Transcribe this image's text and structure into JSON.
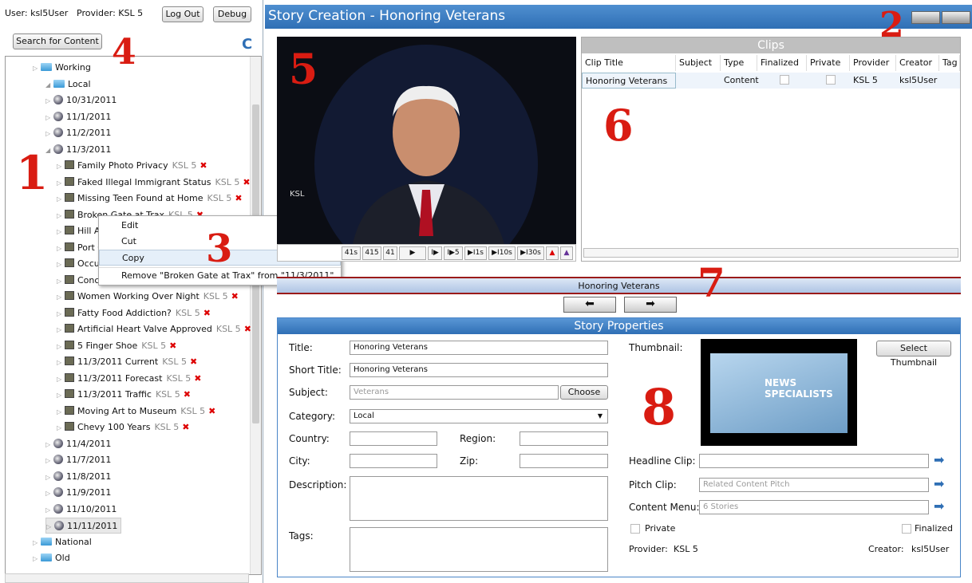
{
  "left": {
    "user_label": "User: ksl5User",
    "provider_label": "Provider: KSL 5",
    "logout_label": "Log Out",
    "debug_label": "Debug",
    "search_label": "Search for Content",
    "refresh_icon": "C",
    "tree": {
      "working": "Working",
      "local": "Local",
      "dates_top": [
        "10/31/2011",
        "11/1/2011",
        "11/2/2011",
        "11/3/2011"
      ],
      "stories": [
        {
          "title": "Family Photo Privacy",
          "prov": "KSL 5"
        },
        {
          "title": "Faked Illegal Immigrant Status",
          "prov": "KSL 5"
        },
        {
          "title": "Missing Teen Found at Home",
          "prov": "KSL 5"
        },
        {
          "title": "Broken Gate at Trax",
          "prov": "KSL 5"
        },
        {
          "title": "Hill A.F",
          "prov": ""
        },
        {
          "title": "Port O",
          "prov": ""
        },
        {
          "title": "Occupy",
          "prov": ""
        },
        {
          "title": "Concer",
          "prov": ""
        },
        {
          "title": "Women Working Over Night",
          "prov": "KSL 5"
        },
        {
          "title": "Fatty Food Addiction?",
          "prov": "KSL 5"
        },
        {
          "title": "Artificial Heart Valve Approved",
          "prov": "KSL 5"
        },
        {
          "title": "5 Finger Shoe",
          "prov": "KSL 5"
        },
        {
          "title": "11/3/2011 Current",
          "prov": "KSL 5"
        },
        {
          "title": "11/3/2011 Forecast",
          "prov": "KSL 5"
        },
        {
          "title": "11/3/2011 Traffic",
          "prov": "KSL 5"
        },
        {
          "title": "Moving Art to Museum",
          "prov": "KSL 5"
        },
        {
          "title": "Chevy 100 Years",
          "prov": "KSL 5"
        }
      ],
      "dates_bottom": [
        "11/4/2011",
        "11/7/2011",
        "11/8/2011",
        "11/9/2011",
        "11/10/2011",
        "11/11/2011"
      ],
      "national": "National",
      "old": "Old"
    },
    "context_menu": [
      "Edit",
      "Cut",
      "Copy",
      "Remove \"Broken Gate at Trax\" from \"11/3/2011\""
    ]
  },
  "header": {
    "title": "Story Creation - Honoring Veterans"
  },
  "controls": [
    "41s",
    "415",
    "41",
    "▶",
    "I▶",
    "I▶5",
    "▶I1s",
    "▶I10s",
    "▶I30s"
  ],
  "clips": {
    "title": "Clips",
    "columns": [
      "Clip Title",
      "Subject",
      "Type",
      "Finalized",
      "Private",
      "Provider",
      "Creator",
      "Tag"
    ],
    "row": {
      "title": "Honoring Veterans",
      "subject": "",
      "type": "Content",
      "provider": "KSL 5",
      "creator": "ksl5User"
    }
  },
  "timeline": {
    "label": "Honoring Veterans"
  },
  "props": {
    "title": "Story Properties",
    "title_label": "Title:",
    "title_value": "Honoring Veterans",
    "short_label": "Short Title:",
    "short_value": "Honoring Veterans",
    "subject_label": "Subject:",
    "subject_placeholder": "Veterans",
    "choose_label": "Choose",
    "category_label": "Category:",
    "category_value": "Local",
    "country_label": "Country:",
    "region_label": "Region:",
    "city_label": "City:",
    "zip_label": "Zip:",
    "description_label": "Description:",
    "tags_label": "Tags:",
    "thumbnail_label": "Thumbnail:",
    "select_thumb_label": "Select Thumbnail",
    "thumb_text": "NEWS SPECIALISTS",
    "headline_label": "Headline Clip:",
    "pitch_label": "Pitch Clip:",
    "pitch_placeholder": "Related Content Pitch",
    "content_menu_label": "Content Menu:",
    "content_menu_placeholder": "6 Stories",
    "private_label": "Private",
    "finalized_label": "Finalized",
    "provider_label": "Provider:",
    "provider_value": "KSL 5",
    "creator_label": "Creator:",
    "creator_value": "ksl5User"
  },
  "annotations": [
    "1",
    "2",
    "3",
    "4",
    "5",
    "6",
    "7",
    "8"
  ],
  "colors": {
    "header": "#2f6fb5",
    "annotation": "#d91c12"
  }
}
